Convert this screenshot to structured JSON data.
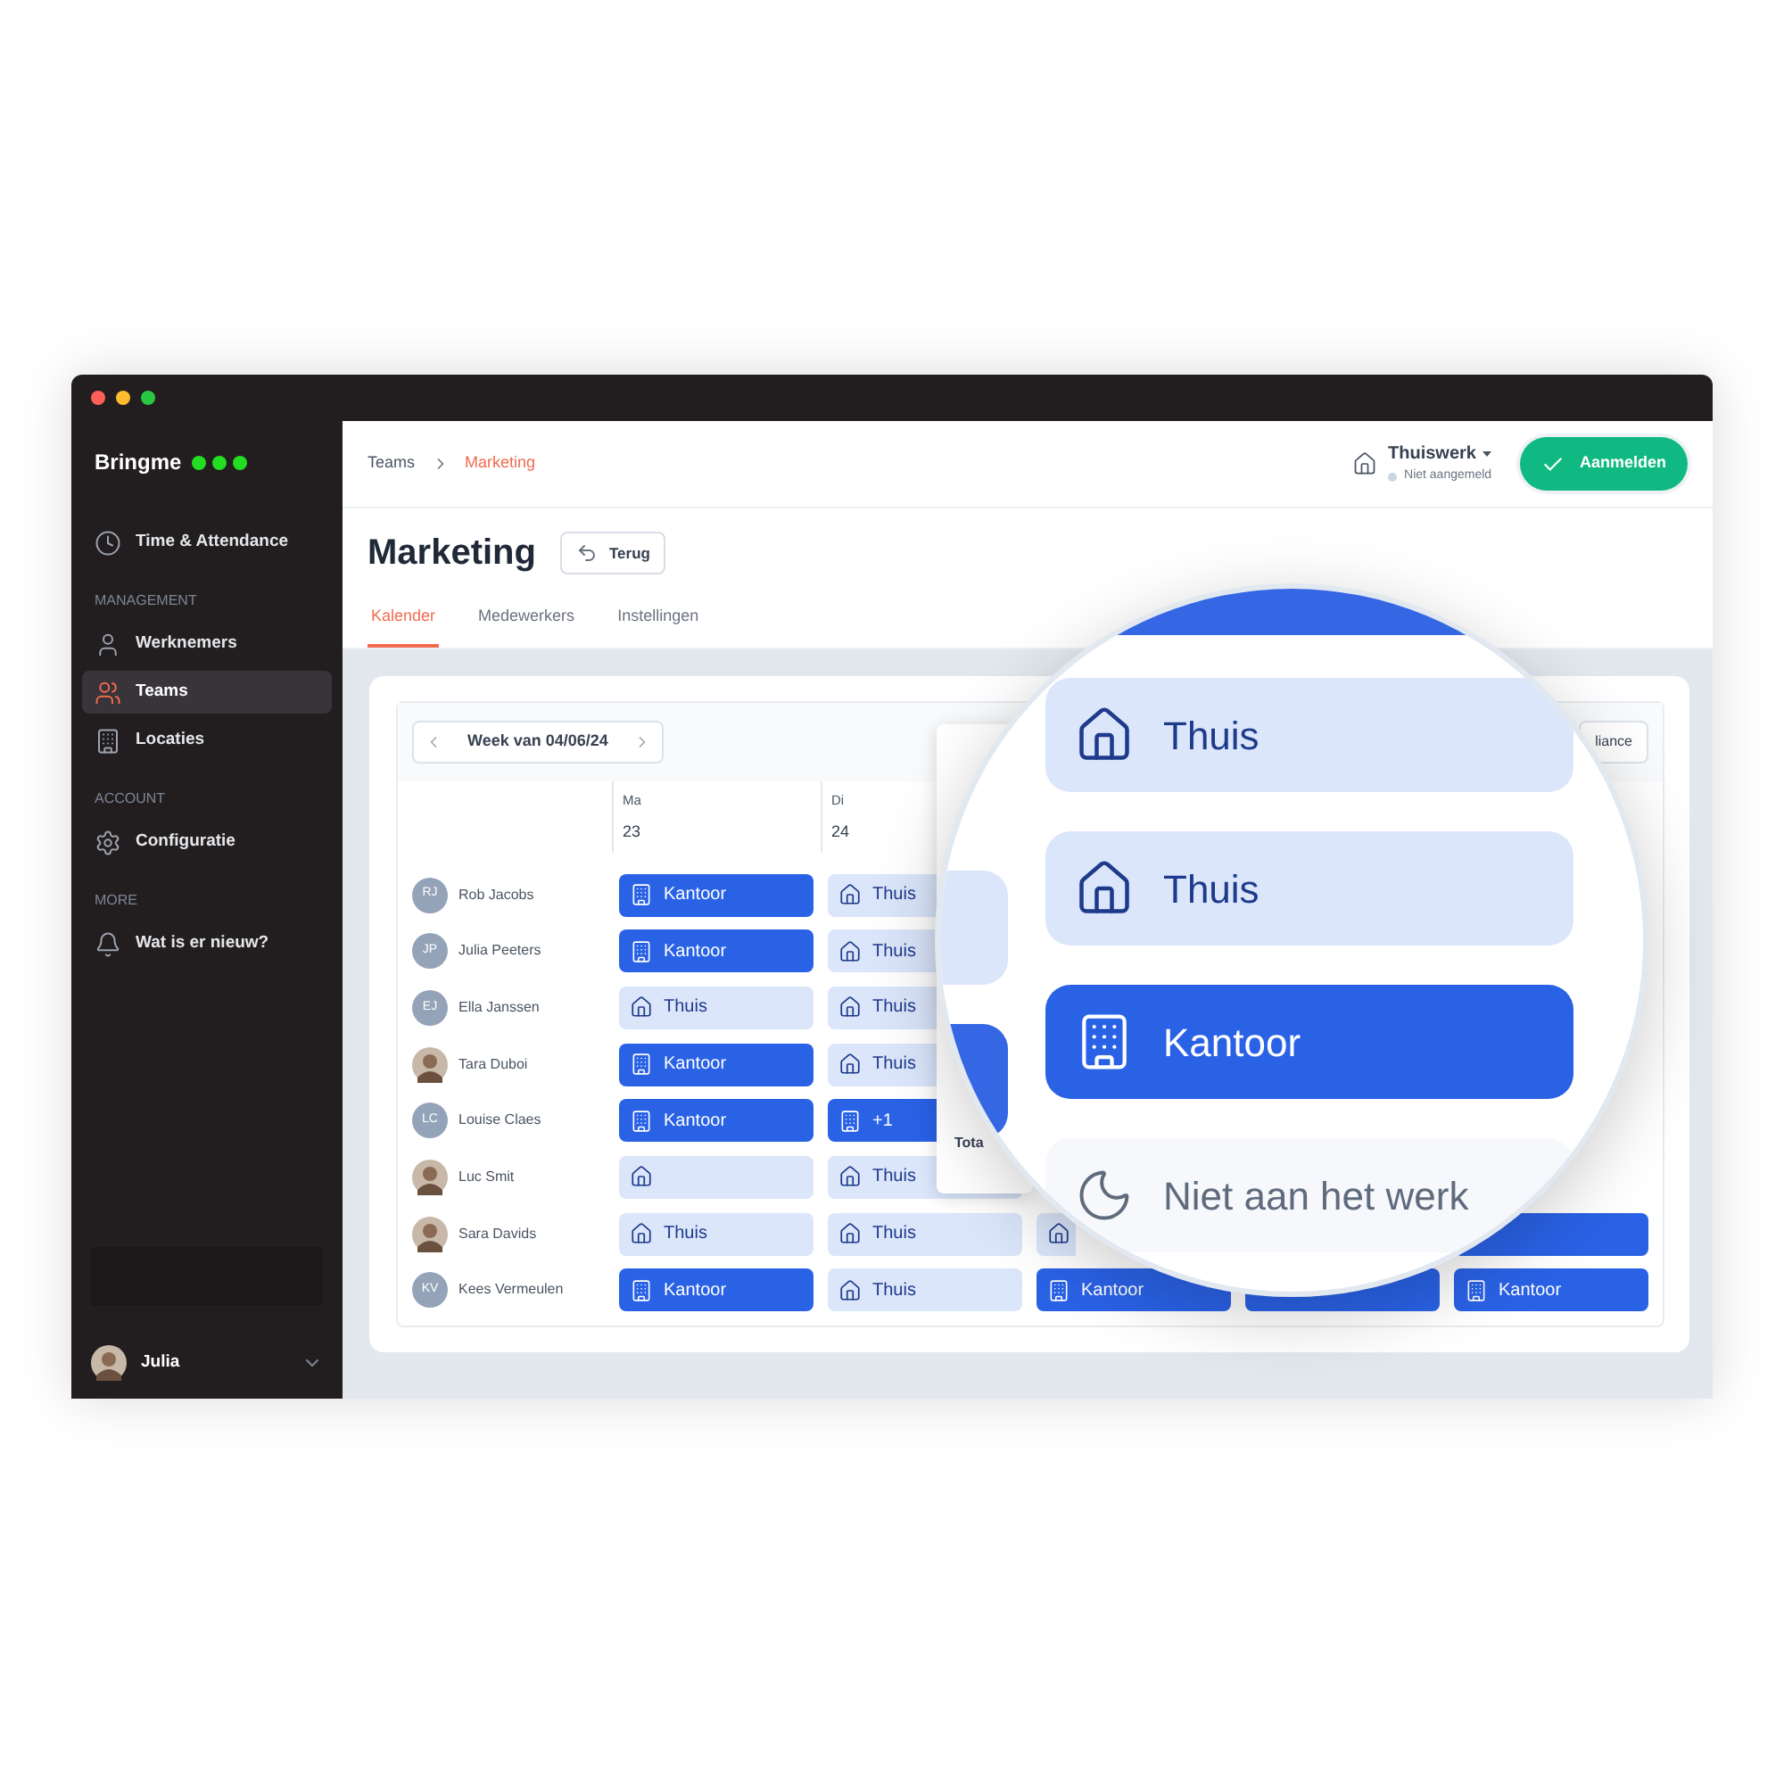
{
  "window": {
    "logo": "Bringme"
  },
  "sidebar": {
    "sections": [
      {
        "items": [
          {
            "label": "Time & Attendance",
            "kind": "clock",
            "selected": false
          }
        ]
      },
      {
        "heading": "MANAGEMENT",
        "items": [
          {
            "label": "Werknemers",
            "kind": "user",
            "selected": false
          },
          {
            "label": "Teams",
            "kind": "users",
            "selected": true
          },
          {
            "label": "Locaties",
            "kind": "building",
            "selected": false
          }
        ]
      },
      {
        "heading": "ACCOUNT",
        "items": [
          {
            "label": "Configuratie",
            "kind": "gear",
            "selected": false
          }
        ]
      },
      {
        "heading": "MORE",
        "items": [
          {
            "label": "Wat is er nieuw?",
            "kind": "bell",
            "selected": false
          }
        ]
      }
    ],
    "user": {
      "name": "Julia"
    }
  },
  "header": {
    "breadcrumb": [
      "Teams",
      "Marketing"
    ],
    "location": "Thuiswerk",
    "status": "Niet aangemeld",
    "action": "Aanmelden"
  },
  "page": {
    "title": "Marketing",
    "back": "Terug",
    "tabs": [
      {
        "label": "Kalender",
        "selected": true
      },
      {
        "label": "Medewerkers",
        "selected": false
      },
      {
        "label": "Instellingen",
        "selected": false
      }
    ]
  },
  "calendar": {
    "week": "Week van 04/06/24",
    "right_button": "liance",
    "days": [
      {
        "name": "Ma",
        "date": "23"
      },
      {
        "name": "Di",
        "date": "24"
      }
    ],
    "rows": [
      {
        "name": "Rob Jacobs",
        "avatar": {
          "kind": "initials",
          "initials": "RJ"
        },
        "cells": [
          {
            "kind": "kantoor",
            "label": "Kantoor"
          },
          {
            "kind": "thuis",
            "label": "Thuis"
          },
          {
            "kind": "none"
          },
          {
            "kind": "none"
          },
          {
            "kind": "none"
          }
        ]
      },
      {
        "name": "Julia Peeters",
        "avatar": {
          "kind": "initials",
          "initials": "JP"
        },
        "cells": [
          {
            "kind": "kantoor",
            "label": "Kantoor"
          },
          {
            "kind": "thuis",
            "label": "Thuis"
          },
          {
            "kind": "none"
          },
          {
            "kind": "none"
          },
          {
            "kind": "none"
          }
        ]
      },
      {
        "name": "Ella Janssen",
        "avatar": {
          "kind": "initials",
          "initials": "EJ"
        },
        "cells": [
          {
            "kind": "thuis",
            "label": "Thuis"
          },
          {
            "kind": "thuis",
            "label": "Thuis"
          },
          {
            "kind": "none"
          },
          {
            "kind": "none"
          },
          {
            "kind": "none"
          }
        ]
      },
      {
        "name": "Tara Duboi",
        "avatar": {
          "kind": "photo"
        },
        "cells": [
          {
            "kind": "kantoor",
            "label": "Kantoor"
          },
          {
            "kind": "thuis",
            "label": "Thuis"
          },
          {
            "kind": "none"
          },
          {
            "kind": "none"
          },
          {
            "kind": "none"
          }
        ]
      },
      {
        "name": "Louise Claes",
        "avatar": {
          "kind": "initials",
          "initials": "LC"
        },
        "cells": [
          {
            "kind": "kantoor",
            "label": "Kantoor"
          },
          {
            "kind": "kantoor",
            "label": "+1"
          },
          {
            "kind": "none"
          },
          {
            "kind": "none"
          },
          {
            "kind": "none"
          }
        ]
      },
      {
        "name": "Luc Smit",
        "avatar": {
          "kind": "photo"
        },
        "cells": [
          {
            "kind": "thuis"
          },
          {
            "kind": "thuis",
            "label": "Thuis"
          },
          {
            "kind": "none"
          },
          {
            "kind": "none"
          },
          {
            "kind": "none"
          }
        ]
      },
      {
        "name": "Sara Davids",
        "avatar": {
          "kind": "photo"
        },
        "cells": [
          {
            "kind": "thuis",
            "label": "Thuis"
          },
          {
            "kind": "thuis",
            "label": "Thuis"
          },
          {
            "kind": "thuis-edge"
          },
          {
            "kind": "none"
          },
          {
            "kind": "kantoor-blank"
          }
        ]
      },
      {
        "name": "Kees Vermeulen",
        "avatar": {
          "kind": "initials",
          "initials": "KV"
        },
        "cells": [
          {
            "kind": "kantoor",
            "label": "Kantoor"
          },
          {
            "kind": "thuis",
            "label": "Thuis"
          },
          {
            "kind": "kantoor",
            "label": "Kantoor"
          },
          {
            "kind": "kantoor-blank"
          },
          {
            "kind": "kantoor",
            "label": "Kantoor"
          }
        ]
      }
    ],
    "popover": {
      "label": "Tota"
    }
  },
  "magnifier": {
    "items": [
      {
        "kind": "thuis",
        "label": "Thuis"
      },
      {
        "kind": "thuis",
        "label": "Thuis"
      },
      {
        "kind": "kantoor",
        "label": "Kantoor"
      },
      {
        "kind": "off",
        "label": "Niet aan het werk"
      }
    ]
  }
}
